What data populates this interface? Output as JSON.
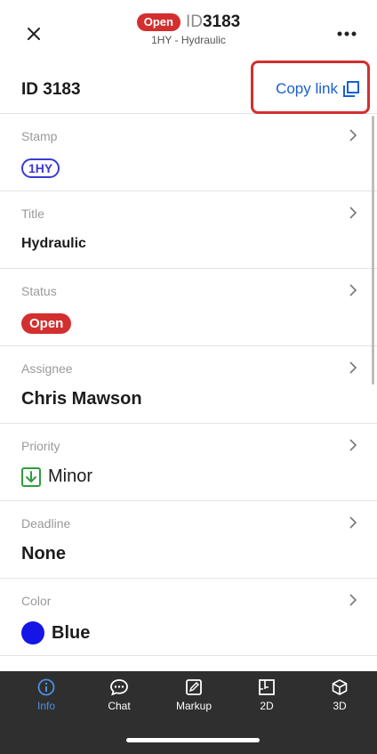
{
  "header": {
    "status_badge": "Open",
    "id_prefix": "ID",
    "id_number": "3183",
    "subtitle": "1HY - Hydraulic"
  },
  "id_row": {
    "label": "ID 3183",
    "copy_link_label": "Copy link"
  },
  "fields": {
    "stamp": {
      "label": "Stamp",
      "value": "1HY"
    },
    "title": {
      "label": "Title",
      "value": "Hydraulic"
    },
    "status": {
      "label": "Status",
      "value": "Open"
    },
    "assignee": {
      "label": "Assignee",
      "value": "Chris Mawson"
    },
    "priority": {
      "label": "Priority",
      "value": "Minor"
    },
    "deadline": {
      "label": "Deadline",
      "value": "None"
    },
    "color": {
      "label": "Color",
      "value": "Blue"
    }
  },
  "bottom_nav": {
    "info": "Info",
    "chat": "Chat",
    "markup": "Markup",
    "plan2d": "2D",
    "model3d": "3D"
  },
  "colors": {
    "status_open": "#d32f2f",
    "link_blue": "#1a5fd0",
    "stamp_blue": "#3a3ad6",
    "minor_green": "#2e9e3e",
    "color_blue": "#1515e6",
    "nav_active": "#4f8fe0"
  }
}
